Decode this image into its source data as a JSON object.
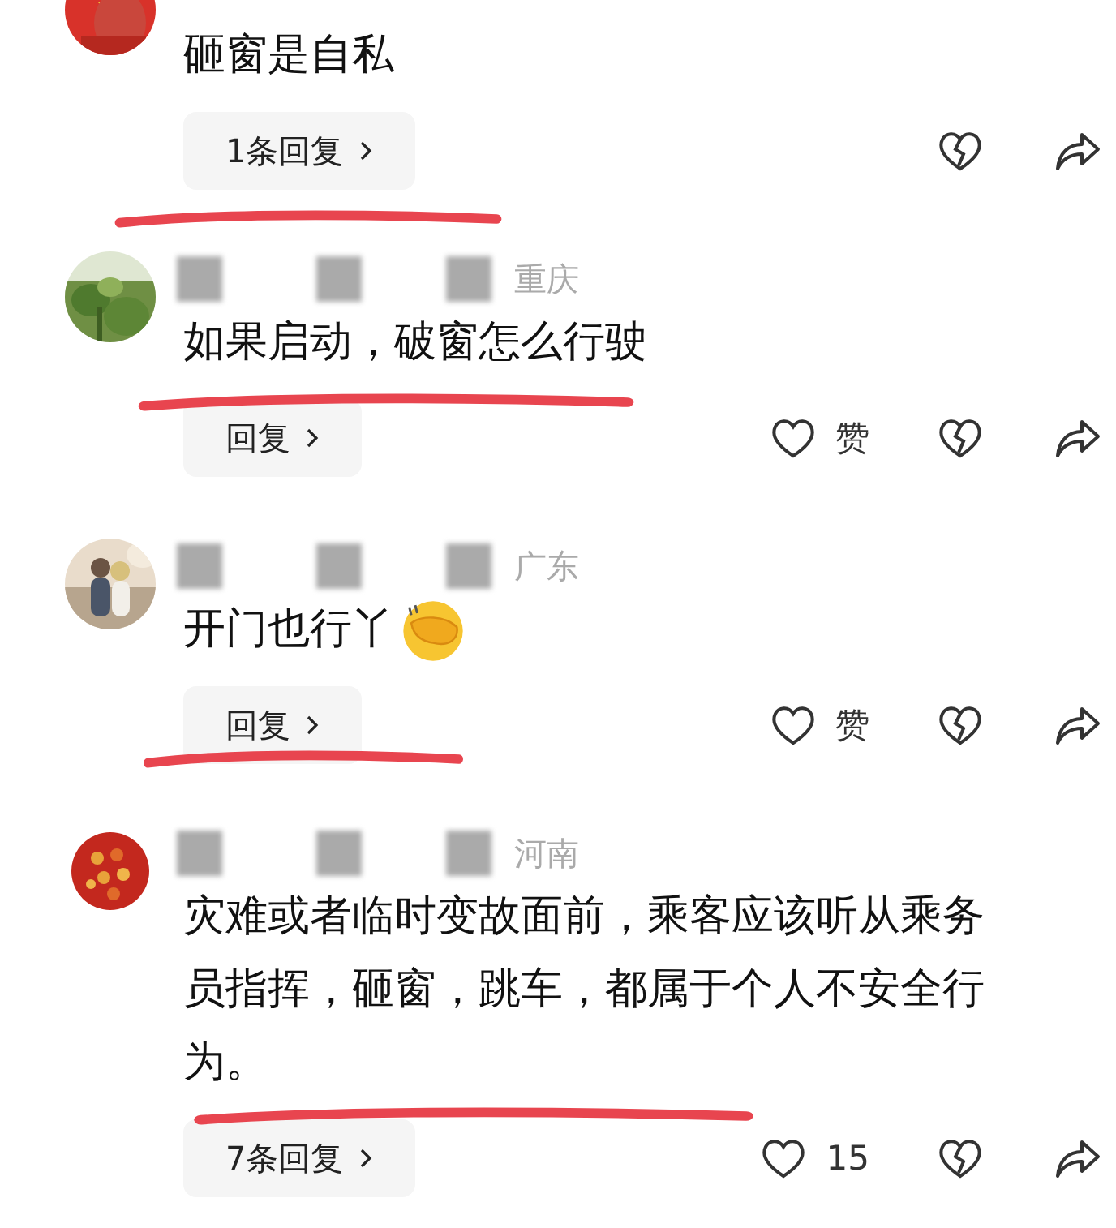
{
  "comments": [
    {
      "kind": "picture",
      "text": "砸窗是自私",
      "reply": "1条回复",
      "underline": {
        "kind": "below_reply"
      }
    },
    {
      "kind": "picture",
      "meta": {
        "redacted": true,
        "location": "重庆"
      },
      "text": "如果启动，破窗怎么行驶",
      "reply": "回复",
      "like": {
        "label": "赞"
      },
      "underline": {
        "kind": "below_text"
      }
    },
    {
      "kind": "picture",
      "meta": {
        "redacted": true,
        "location": "广东"
      },
      "text": "开门也行丫",
      "emoji": true,
      "reply": "回复",
      "like": {
        "label": "赞"
      },
      "underline": {
        "kind": "through_reply"
      }
    },
    {
      "kind": "picture",
      "meta": {
        "redacted": true,
        "location": "河南"
      },
      "text": "灾难或者临时变故面前，乘客应该听从乘务员指挥，砸窗，跳车，都属于个人不安全行为。",
      "reply": "7条回复",
      "like": {
        "label": "15"
      },
      "underline": {
        "kind": "below_text"
      }
    }
  ]
}
